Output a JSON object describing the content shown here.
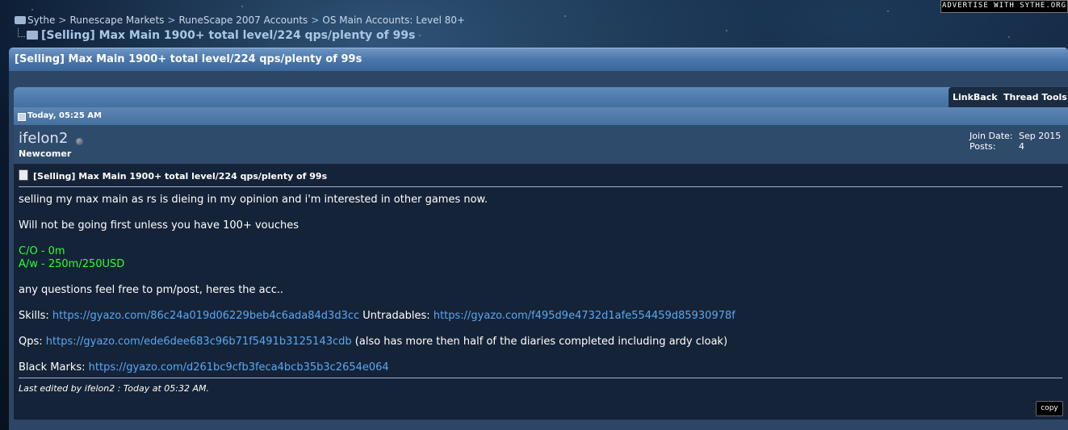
{
  "breadcrumb": {
    "items": [
      "Sythe",
      "Runescape Markets",
      "RuneScape 2007 Accounts",
      "OS Main Accounts: Level 80+"
    ],
    "separator": ">",
    "current": "[Selling] Max Main 1900+ total level/224 qps/plenty of 99s"
  },
  "advert": "ADVERTISE WITH SYTHE.ORG",
  "thread": {
    "title": "[Selling] Max Main 1900+ total level/224 qps/plenty of 99s",
    "tabs": {
      "linkback": "LinkBack",
      "thread_tools": "Thread Tools"
    }
  },
  "post": {
    "date": "Today, 05:25 AM",
    "username": "ifelon2",
    "rank": "Newcomer",
    "join_label": "Join Date:",
    "join_value": "Sep 2015",
    "posts_label": "Posts:",
    "posts_value": "4",
    "title": "[Selling] Max Main 1900+ total level/224 qps/plenty of 99s",
    "line1": "selling my max main as rs is dieing in my opinion and i'm interested in other games now.",
    "line2": "Will not be going first unless you have 100+ vouches",
    "co": "C/O - 0m",
    "aw": "A/w - 250m/250USD",
    "line3": "any questions feel free to pm/post, heres the acc..",
    "skills_label": "Skills:",
    "skills_link": "https://gyazo.com/86c24a019d06229beb4c6ada84d3d3cc",
    "untradables_label": "Untradables:",
    "untradables_link": "https://gyazo.com/f495d9e4732d1afe554459d85930978f",
    "qps_label": "Qps:",
    "qps_link": "https://gyazo.com/ede6dee683c96b71f5491b3125143cdb",
    "qps_note": "(also has more then half of the diaries completed including ardy cloak)",
    "bm_label": "Black Marks:",
    "bm_link": "https://gyazo.com/d261bc9cfb3feca4bcb35b3c2654e064",
    "edited": "Last edited by ifelon2 : Today at 05:32 AM.",
    "copy_button": "copy"
  },
  "colors": {
    "thread_bar": "#4a76a9",
    "post_bg": "#152338",
    "green_text": "#2dff32",
    "link": "#59a8f0"
  }
}
